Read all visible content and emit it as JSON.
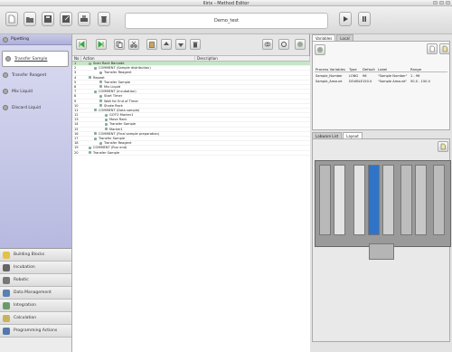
{
  "window": {
    "title": "Ilirix - Method Editor"
  },
  "toolbar": {
    "filename": "Demo_test",
    "buttons": [
      "new-file",
      "open",
      "save",
      "save-as",
      "print",
      "delete"
    ],
    "run_buttons": [
      "run",
      "pause"
    ]
  },
  "left": {
    "top_category": "Pipetting",
    "pipetting_items": [
      "Transfer Sample",
      "Transfer Reagent",
      "Mix Liquid",
      "Discard Liquid"
    ],
    "categories": [
      "Building Blocks",
      "Incubation",
      "Robotic",
      "Data Management",
      "Integration",
      "Calculation",
      "Programming Actions"
    ]
  },
  "grid": {
    "headers": {
      "no": "No",
      "action": "Action",
      "description": "Description"
    },
    "rows": [
      {
        "no": "1",
        "text": "Scan Rack Barcode",
        "indent": 1,
        "selected": true
      },
      {
        "no": "2",
        "text": "COMMENT (Sample distribution)",
        "indent": 2
      },
      {
        "no": "3",
        "text": "Transfer Reagent",
        "indent": 3
      },
      {
        "no": "4",
        "text": "Repeat",
        "indent": 1
      },
      {
        "no": "5",
        "text": "Transfer Sample",
        "indent": 3
      },
      {
        "no": "6",
        "text": "Mix Liquid",
        "indent": 3
      },
      {
        "no": "7",
        "text": "COMMENT (Incubation)",
        "indent": 2
      },
      {
        "no": "8",
        "text": "Start Timer",
        "indent": 3
      },
      {
        "no": "9",
        "text": "Wait for End of Timer",
        "indent": 3
      },
      {
        "no": "10",
        "text": "Shake Rack",
        "indent": 3
      },
      {
        "no": "11",
        "text": "COMMENT (Data sample)",
        "indent": 2
      },
      {
        "no": "12",
        "text": "GOTO Marker1",
        "indent": 4
      },
      {
        "no": "13",
        "text": "Move Rack",
        "indent": 4
      },
      {
        "no": "14",
        "text": "Transfer Sample",
        "indent": 4
      },
      {
        "no": "15",
        "text": "Marker1",
        "indent": 4
      },
      {
        "no": "16",
        "text": "COMMENT (Final sample preparation)",
        "indent": 2
      },
      {
        "no": "17",
        "text": "Transfer Sample",
        "indent": 2
      },
      {
        "no": "18",
        "text": "Transfer Reagent",
        "indent": 3
      },
      {
        "no": "19",
        "text": "COMMENT (Run end)",
        "indent": 1
      },
      {
        "no": "20",
        "text": "Transfer Sample",
        "indent": 1
      }
    ]
  },
  "right": {
    "top_tabs": [
      "Variables",
      "Local"
    ],
    "var_headers": [
      "Process Variables",
      "Type",
      "Default",
      "Label",
      "Range"
    ],
    "variables": [
      [
        "Sample_Number",
        "LONG",
        "96",
        "\"Sample Number\"",
        "1 - 96"
      ],
      [
        "Sample_Amount",
        "DOUBLE",
        "150.0",
        "\"Sample Amount\"",
        "50.0 - 150.0"
      ]
    ],
    "bottom_tabs": [
      "Labware List",
      "Layout"
    ]
  },
  "colors": {
    "accent": "#b2b4dc",
    "selected_row": "#c6e6c6",
    "blue_rack": "#2f74c8"
  }
}
